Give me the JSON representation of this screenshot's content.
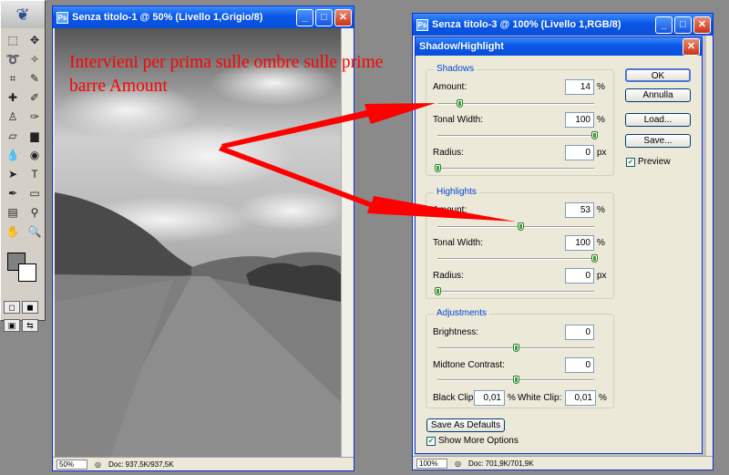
{
  "doc1": {
    "title": "Senza titolo-1 @ 50% (Livello 1,Grigio/8)",
    "status_zoom": "50%",
    "status_doc": "Doc: 937,5K/937,5K"
  },
  "doc2": {
    "title": "Senza titolo-3 @ 100% (Livello 1,RGB/8)",
    "status_zoom": "100%",
    "status_doc": "Doc: 701,9K/701,9K"
  },
  "annotation": {
    "text": "Intervieni per prima sulle ombre sulle prime barre Amount",
    "color": "#ff0000"
  },
  "dialog": {
    "title": "Shadow/Highlight",
    "shadows": {
      "group_label": "Shadows",
      "amount": {
        "label": "Amount:",
        "value": "14",
        "unit": "%",
        "level": 0.14
      },
      "tonal_width": {
        "label": "Tonal Width:",
        "value": "100",
        "unit": "%",
        "level": 1.0
      },
      "radius": {
        "label": "Radius:",
        "value": "0",
        "unit": "px",
        "level": 0.0
      }
    },
    "highlights": {
      "group_label": "Highlights",
      "amount": {
        "label": "Amount:",
        "value": "53",
        "unit": "%",
        "level": 0.53
      },
      "tonal_width": {
        "label": "Tonal Width:",
        "value": "100",
        "unit": "%",
        "level": 1.0
      },
      "radius": {
        "label": "Radius:",
        "value": "0",
        "unit": "px",
        "level": 0.0
      }
    },
    "adjustments": {
      "group_label": "Adjustments",
      "brightness": {
        "label": "Brightness:",
        "value": "0",
        "level": 0.5
      },
      "midtone_contrast": {
        "label": "Midtone Contrast:",
        "value": "0",
        "level": 0.5
      },
      "black_clip": {
        "label": "Black Clip:",
        "value": "0,01",
        "unit": "%"
      },
      "white_clip": {
        "label": "White Clip:",
        "value": "0,01",
        "unit": "%"
      }
    },
    "buttons": {
      "ok": "OK",
      "cancel": "Annulla",
      "load": "Load...",
      "save": "Save...",
      "save_defaults": "Save As Defaults"
    },
    "preview": {
      "label": "Preview",
      "checked": true
    },
    "show_more": {
      "label": "Show More Options",
      "checked": true
    }
  }
}
